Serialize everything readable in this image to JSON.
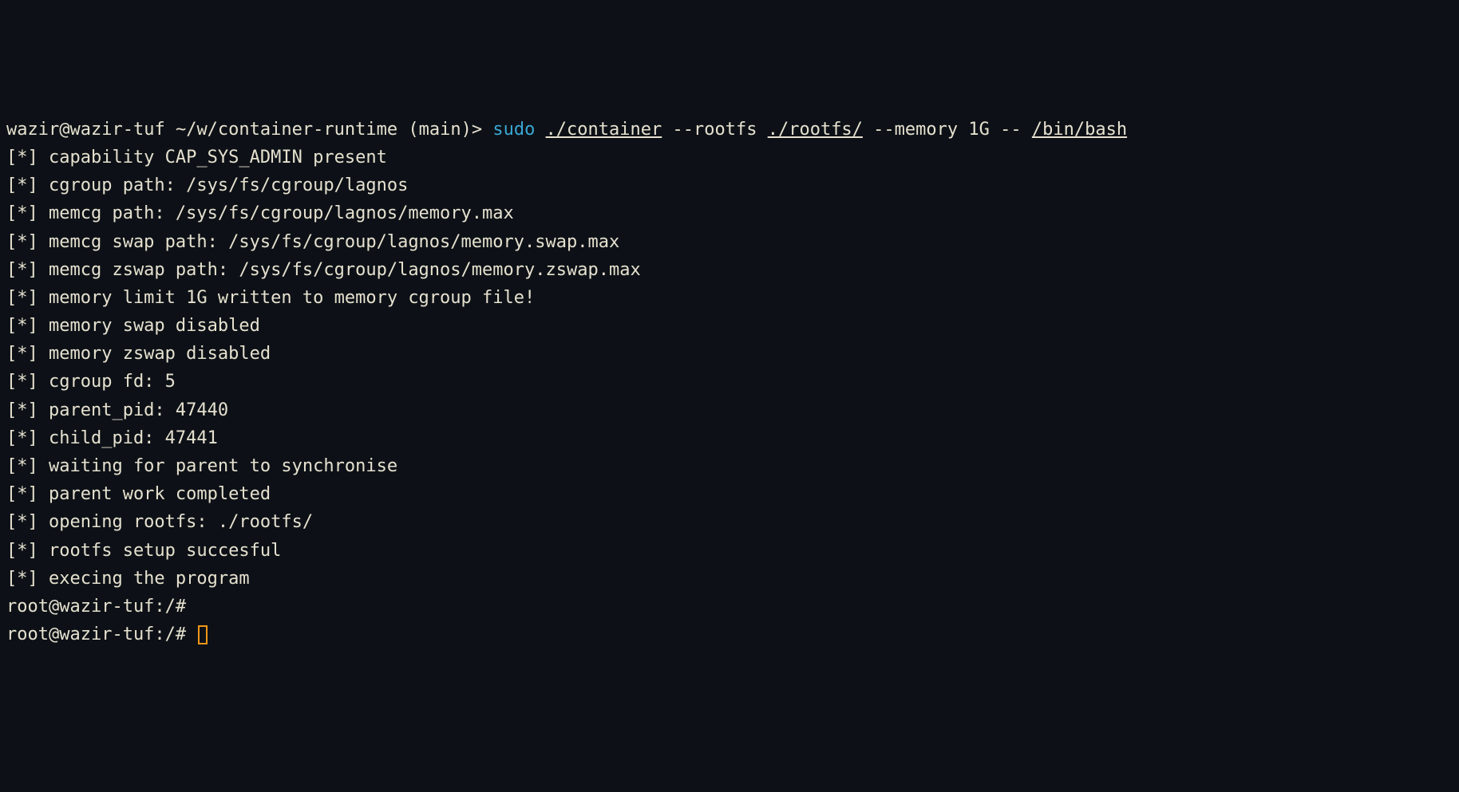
{
  "prompt": {
    "user": "wazir",
    "at": "@",
    "host": "wazir-tuf",
    "path": " ~/w/container-runtime ",
    "branch": "(main)",
    "sep": "> ",
    "sudo": "sudo",
    "sp": " ",
    "container": "./container",
    "rootfs_flag": " --rootfs ",
    "rootfs_path": "./rootfs/",
    "memory_flag": " --memory 1G -- ",
    "bin_bash": "/bin/bash"
  },
  "logs": [
    "[*] capability CAP_SYS_ADMIN present",
    "[*] cgroup path: /sys/fs/cgroup/lagnos",
    "[*] memcg path: /sys/fs/cgroup/lagnos/memory.max",
    "[*] memcg swap path: /sys/fs/cgroup/lagnos/memory.swap.max",
    "[*] memcg zswap path: /sys/fs/cgroup/lagnos/memory.zswap.max",
    "[*] memory limit 1G written to memory cgroup file!",
    "[*] memory swap disabled",
    "[*] memory zswap disabled",
    "[*] cgroup fd: 5",
    "[*] parent_pid: 47440",
    "[*] child_pid: 47441",
    "[*] waiting for parent to synchronise",
    "[*] parent work completed",
    "[*] opening rootfs: ./rootfs/",
    "[*] rootfs setup succesful",
    "[*] execing the program"
  ],
  "inner_prompts": [
    "root@wazir-tuf:/#",
    "root@wazir-tuf:/# "
  ]
}
